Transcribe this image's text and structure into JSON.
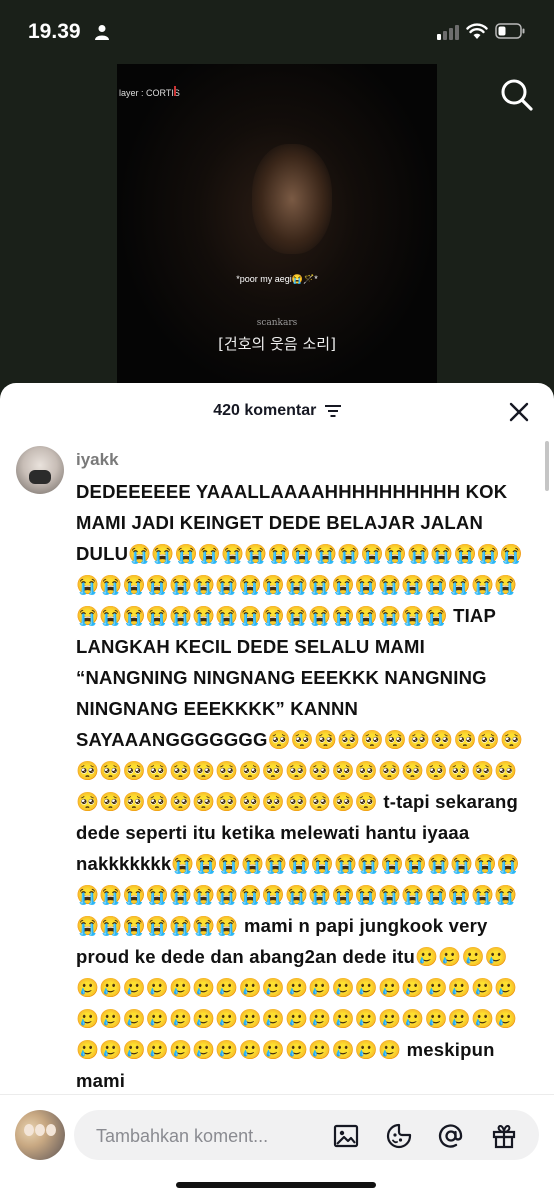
{
  "status_bar": {
    "time": "19.39",
    "person_icon": "person-icon",
    "signal_icon": "cellular-signal-icon",
    "wifi_icon": "wifi-icon",
    "battery_icon": "battery-icon"
  },
  "video": {
    "overlay_label": "layer : CORTIS",
    "caption": "*poor my aegi😭🪄*",
    "credit": "scankars",
    "korean_subtitle": "[건호의 웃음 소리]"
  },
  "top_actions": {
    "search_icon": "search-icon"
  },
  "comments_panel": {
    "count_label": "420 komentar",
    "sort_icon": "sort-icon",
    "close_icon": "close-icon",
    "comment": {
      "username": "iyakk",
      "text": "DEDEEEEEE YAAALLAAAAHHHHHHHHHH KOK MAMI JADI KEINGET DEDE BELAJAR JALAN DULU😭😭😭😭😭😭😭😭😭😭😭😭😭😭😭😭😭😭😭😭😭😭😭😭😭😭😭😭😭😭😭😭😭😭😭😭😭😭😭😭😭😭😭😭😭😭😭😭😭😭😭😭 TIAP LANGKAH KECIL DEDE SELALU MAMI “NANGNING NINGNANG EEEKKK NANGNING NINGNANG EEEKKKK” KANNN SAYAAANGGGGGGG🥺🥺🥺🥺🥺🥺🥺🥺🥺🥺🥺🥺🥺🥺🥺🥺🥺🥺🥺🥺🥺🥺🥺🥺🥺🥺🥺🥺🥺🥺🥺🥺🥺🥺🥺🥺🥺🥺🥺🥺🥺🥺🥺 t-tapi sekarang dede seperti itu ketika melewati hantu iyaaa nakkkkkkk😭😭😭😭😭😭😭😭😭😭😭😭😭😭😭😭😭😭😭😭😭😭😭😭😭😭😭😭😭😭😭😭😭😭😭😭😭😭😭😭😭 mami n papi jungkook very proud ke dede dan abang2an dede itu🥲🥲🥲🥲🥲🥲🥲🥲🥲🥲🥲🥲🥲🥲🥲🥲🥲🥲🥲🥲🥲🥲🥲🥲🥲🥲🥲🥲🥲🥲🥲🥲🥲🥲🥲🥲🥲🥲🥲🥲🥲🥲🥲🥲🥲🥲🥲🥲🥲🥲🥲🥲🥲🥲🥲🥲 meskipun mami"
    }
  },
  "input_bar": {
    "placeholder": "Tambahkan koment...",
    "image_icon": "image-icon",
    "sticker_icon": "sticker-icon",
    "mention_icon": "mention-icon",
    "gift_icon": "gift-icon"
  },
  "colors": {
    "background": "#1a2019",
    "sheet": "#ffffff",
    "input_pill": "#f1f1f2",
    "username": "#7a7a7a"
  }
}
